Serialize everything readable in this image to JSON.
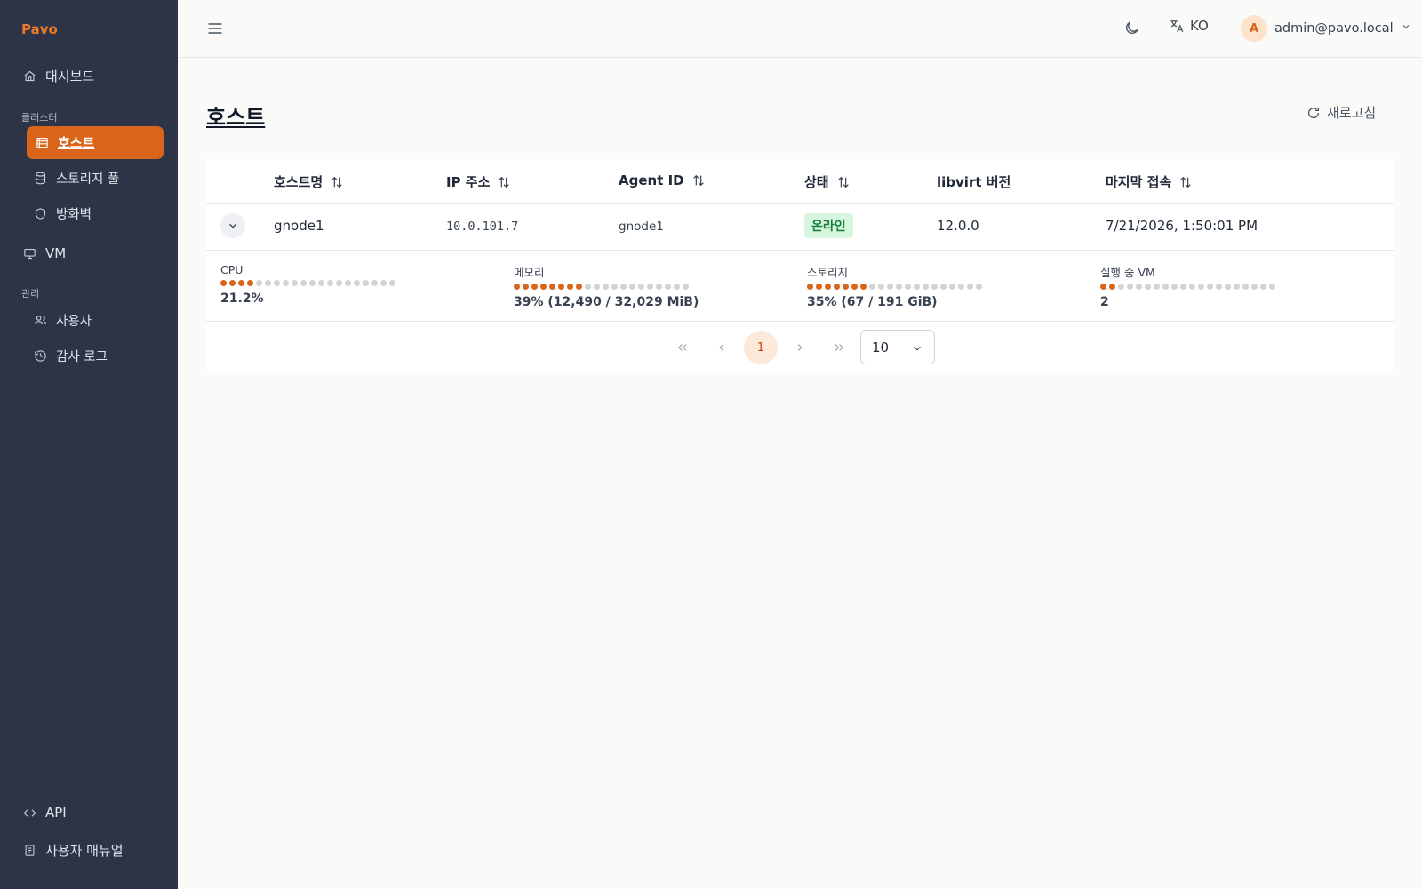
{
  "app": {
    "brand": "Pavo"
  },
  "sidebar": {
    "dashboard": "대시보드",
    "cluster_section": "클러스터",
    "hosts": "호스트",
    "storage_pool": "스토리지 풀",
    "firewall": "방화벽",
    "vm": "VM",
    "admin_section": "관리",
    "users": "사용자",
    "audit_log": "감사 로그",
    "api": "API",
    "user_manual": "사용자 매뉴얼"
  },
  "header": {
    "language": "KO",
    "avatar_initial": "A",
    "user_email": "admin@pavo.local"
  },
  "page": {
    "title": "호스트",
    "refresh_label": "새로고침"
  },
  "table": {
    "columns": [
      "호스트명",
      "IP 주소",
      "Agent ID",
      "상태",
      "libvirt 버전",
      "마지막 접속"
    ],
    "rows": [
      {
        "hostname": "gnode1",
        "ip": "10.0.101.7",
        "agent_id": "gnode1",
        "status": "온라인",
        "libvirt": "12.0.0",
        "last_seen": "7/21/2026, 1:50:01 PM",
        "metrics": {
          "cpu": {
            "label": "CPU",
            "value": "21.2%",
            "fraction": 0.212
          },
          "memory": {
            "label": "메모리",
            "value": "39% (12,490 / 32,029 MiB)",
            "fraction": 0.39
          },
          "storage": {
            "label": "스토리지",
            "value": "35% (67 / 191 GiB)",
            "fraction": 0.35
          },
          "running_vms": {
            "label": "실행 중 VM",
            "value": "2",
            "fraction": 0.1
          }
        }
      }
    ]
  },
  "pagination": {
    "current_page": "1",
    "page_size": "10"
  },
  "colors": {
    "accent": "#d9651b",
    "sidebar_bg": "#2e3447",
    "online_bg": "#d8f5df",
    "online_fg": "#15803d"
  },
  "icons": {
    "dashboard": "home-icon",
    "hosts": "server-icon",
    "storage": "database-icon",
    "firewall": "shield-icon",
    "vm": "monitor-icon",
    "users": "users-icon",
    "audit": "history-icon",
    "api": "code-icon",
    "manual": "book-icon"
  }
}
